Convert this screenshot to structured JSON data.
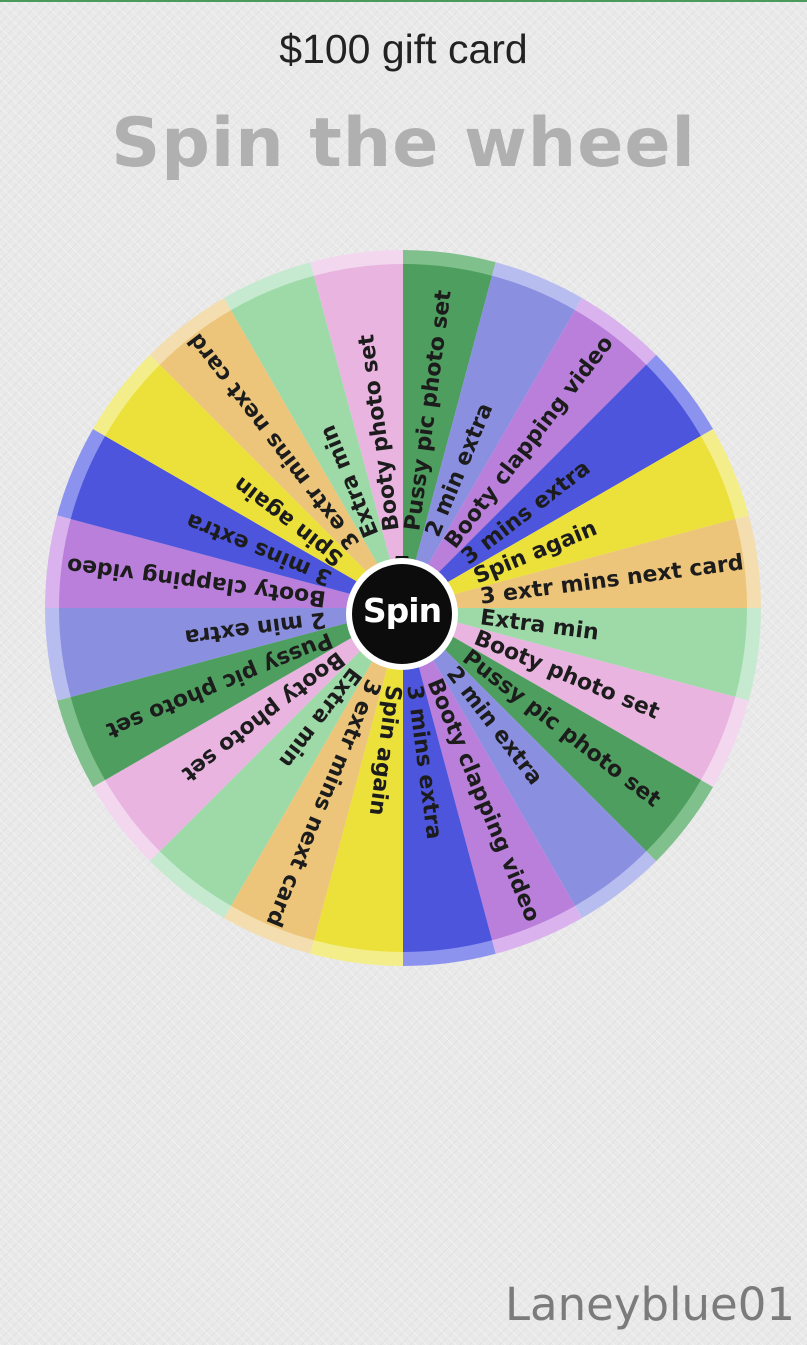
{
  "header": {
    "gift_title": "$100 gift card",
    "main_title": "Spin the wheel"
  },
  "wheel": {
    "spin_label": "Spin",
    "segments": [
      {
        "label": "Pussy pic photo set",
        "color": "#4e9e5f",
        "rim": "#7fc08c"
      },
      {
        "label": "2 min extra",
        "color": "#8a8fe0",
        "rim": "#b8bdf0"
      },
      {
        "label": "Booty clapping video",
        "color": "#b97fdb",
        "rim": "#dab3ee"
      },
      {
        "label": "3 mins extra",
        "color": "#4c55dc",
        "rim": "#8c93ee"
      },
      {
        "label": "Spin again",
        "color": "#ece03a",
        "rim": "#f4ee8a"
      },
      {
        "label": "3 extr mins next card",
        "color": "#ecc57a",
        "rim": "#f4deaf"
      },
      {
        "label": "Extra min",
        "color": "#9edaa8",
        "rim": "#c5ead0"
      },
      {
        "label": "Booty photo set",
        "color": "#e9b5e0",
        "rim": "#f3d7ee"
      },
      {
        "label": "Pussy pic photo set",
        "color": "#4e9e5f",
        "rim": "#7fc08c"
      },
      {
        "label": "2 min extra",
        "color": "#8a8fe0",
        "rim": "#b8bdf0"
      },
      {
        "label": "Booty clapping video",
        "color": "#b97fdb",
        "rim": "#dab3ee"
      },
      {
        "label": "3 mins extra",
        "color": "#4c55dc",
        "rim": "#8c93ee"
      },
      {
        "label": "Spin again",
        "color": "#ece03a",
        "rim": "#f4ee8a"
      },
      {
        "label": "3 extr mins next card",
        "color": "#ecc57a",
        "rim": "#f4deaf"
      },
      {
        "label": "Extra min",
        "color": "#9edaa8",
        "rim": "#c5ead0"
      },
      {
        "label": "Booty photo set",
        "color": "#e9b5e0",
        "rim": "#f3d7ee"
      },
      {
        "label": "Pussy pic photo set",
        "color": "#4e9e5f",
        "rim": "#7fc08c"
      },
      {
        "label": "2 min extra",
        "color": "#8a8fe0",
        "rim": "#b8bdf0"
      },
      {
        "label": "Booty clapping video",
        "color": "#b97fdb",
        "rim": "#dab3ee"
      },
      {
        "label": "3 mins extra",
        "color": "#4c55dc",
        "rim": "#8c93ee"
      },
      {
        "label": "Spin again",
        "color": "#ece03a",
        "rim": "#f4ee8a"
      },
      {
        "label": "3 extr mins next card",
        "color": "#ecc57a",
        "rim": "#f4deaf"
      },
      {
        "label": "Extra min",
        "color": "#9edaa8",
        "rim": "#c5ead0"
      },
      {
        "label": "Booty photo set",
        "color": "#e9b5e0",
        "rim": "#f3d7ee"
      }
    ]
  },
  "footer": {
    "username": "Laneyblue01"
  }
}
